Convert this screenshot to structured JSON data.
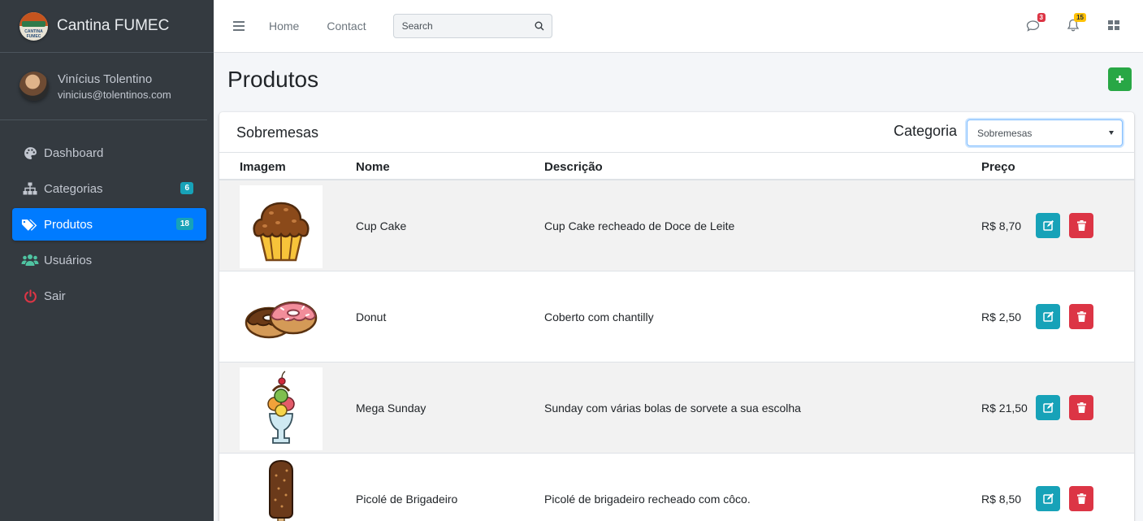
{
  "brand": {
    "name": "Cantina FUMEC",
    "logo_text": "CANTINA FUMEC"
  },
  "user": {
    "name": "Vinícius Tolentino",
    "email": "vinicius@tolentinos.com"
  },
  "sidebar": {
    "items": [
      {
        "label": "Dashboard",
        "icon": "palette-icon",
        "badge": "",
        "active": false
      },
      {
        "label": "Categorias",
        "icon": "sitemap-icon",
        "badge": "6",
        "active": false
      },
      {
        "label": "Produtos",
        "icon": "tags-icon",
        "badge": "18",
        "active": true
      },
      {
        "label": "Usuários",
        "icon": "users-icon",
        "badge": "",
        "active": false
      },
      {
        "label": "Sair",
        "icon": "power-icon",
        "badge": "",
        "active": false
      }
    ]
  },
  "navbar": {
    "home": "Home",
    "contact": "Contact",
    "search_placeholder": "Search",
    "messages_badge": "3",
    "notifications_badge": "15"
  },
  "page": {
    "title": "Produtos"
  },
  "card": {
    "title": "Sobremesas",
    "category_label": "Categoria",
    "category_selected": "Sobremesas"
  },
  "table": {
    "headers": {
      "image": "Imagem",
      "name": "Nome",
      "description": "Descrição",
      "price": "Preço"
    },
    "rows": [
      {
        "name": "Cup Cake",
        "description": "Cup Cake recheado de Doce de Leite",
        "price": "R$ 8,70",
        "image": "cupcake-image"
      },
      {
        "name": "Donut",
        "description": "Coberto com chantilly",
        "price": "R$ 2,50",
        "image": "donut-image"
      },
      {
        "name": "Mega Sunday",
        "description": "Sunday com várias bolas de sorvete a sua escolha",
        "price": "R$ 21,50",
        "image": "sundae-image"
      },
      {
        "name": "Picolé de Brigadeiro",
        "description": "Picolé de brigadeiro recheado com côco.",
        "price": "R$ 8,50",
        "image": "popsicle-image"
      }
    ]
  },
  "colors": {
    "sidebar_bg": "#343a40",
    "active": "#007bff",
    "success": "#28a745",
    "info": "#17a2b8",
    "danger": "#dc3545",
    "warning": "#ffc107"
  }
}
